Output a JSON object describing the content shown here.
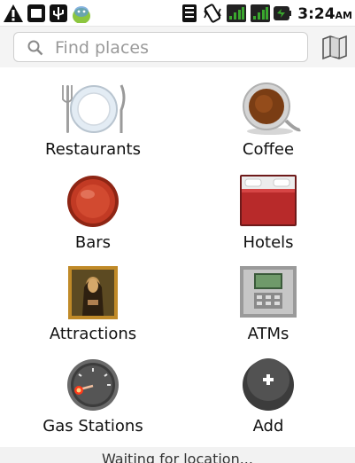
{
  "status_bar": {
    "time": "3:24",
    "ampm": "AM",
    "icons": [
      "warning-icon",
      "sd-card-icon",
      "usb-icon",
      "android-icon",
      "storage-icon",
      "vibrate-icon",
      "wifi-signal-icon",
      "cell-signal-icon",
      "battery-icon"
    ]
  },
  "search": {
    "placeholder": "Find places",
    "value": ""
  },
  "categories": [
    {
      "label": "Restaurants",
      "icon": "plate-icon"
    },
    {
      "label": "Coffee",
      "icon": "coffee-cup-icon"
    },
    {
      "label": "Bars",
      "icon": "bottle-cap-icon"
    },
    {
      "label": "Hotels",
      "icon": "hotel-bed-icon"
    },
    {
      "label": "Attractions",
      "icon": "painting-icon"
    },
    {
      "label": "ATMs",
      "icon": "atm-icon"
    },
    {
      "label": "Gas Stations",
      "icon": "fuel-gauge-icon"
    },
    {
      "label": "Add",
      "icon": "add-icon"
    }
  ],
  "footer": {
    "status": "Waiting for location..."
  },
  "colors": {
    "battery_green": "#3aa82e",
    "signal_green": "#3aa82e",
    "hotel_red": "#b82a2a",
    "bars_red": "#c23a24",
    "add_dark": "#3c3c3c"
  }
}
